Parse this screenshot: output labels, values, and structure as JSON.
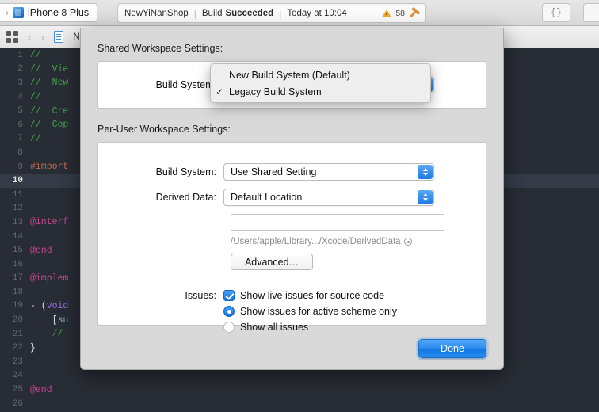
{
  "toolbar": {
    "scheme_separator": "›",
    "device_icon": "device-iphone-icon",
    "scheme_name": "iPhone 8 Plus",
    "project_name": "NewYiNanShop",
    "divider": "|",
    "build_prefix": "Build",
    "build_status": "Succeeded",
    "build_time": "Today at 10:04",
    "warning_icon": "warning-triangle-icon",
    "warning_count": "58",
    "hammer_icon": "hammer-icon",
    "braces_label": "{}"
  },
  "navbar": {
    "grid_icon": "grid-view-icon",
    "back_icon": "‹",
    "forward_icon": "›",
    "file_icon": "document-icon",
    "file_name": "N"
  },
  "editor": {
    "lines": [
      {
        "n": "1",
        "segments": [
          {
            "t": "//",
            "c": "cm"
          }
        ]
      },
      {
        "n": "2",
        "segments": [
          {
            "t": "//  Vie",
            "c": "cm"
          }
        ]
      },
      {
        "n": "3",
        "segments": [
          {
            "t": "//  New",
            "c": "cm"
          }
        ]
      },
      {
        "n": "4",
        "segments": [
          {
            "t": "//",
            "c": "cm"
          }
        ]
      },
      {
        "n": "5",
        "segments": [
          {
            "t": "//  Cre",
            "c": "cm"
          }
        ]
      },
      {
        "n": "6",
        "segments": [
          {
            "t": "//  Cop",
            "c": "cm"
          }
        ]
      },
      {
        "n": "7",
        "segments": [
          {
            "t": "//",
            "c": "cm"
          }
        ]
      },
      {
        "n": "8",
        "segments": []
      },
      {
        "n": "9",
        "segments": [
          {
            "t": "#import",
            "c": "pp"
          }
        ]
      },
      {
        "n": "10",
        "segments": [],
        "highlight": true
      },
      {
        "n": "11",
        "segments": []
      },
      {
        "n": "12",
        "segments": []
      },
      {
        "n": "13",
        "segments": [
          {
            "t": "@interf",
            "c": "kw"
          }
        ]
      },
      {
        "n": "14",
        "segments": []
      },
      {
        "n": "15",
        "segments": [
          {
            "t": "@end",
            "c": "kw"
          }
        ]
      },
      {
        "n": "16",
        "segments": []
      },
      {
        "n": "17",
        "segments": [
          {
            "t": "@implem",
            "c": "kw"
          }
        ]
      },
      {
        "n": "18",
        "segments": []
      },
      {
        "n": "19",
        "segments": [
          {
            "t": "- (",
            "c": "pn"
          },
          {
            "t": "void",
            "c": "ty"
          }
        ]
      },
      {
        "n": "20",
        "segments": [
          {
            "t": "    [",
            "c": "pn"
          },
          {
            "t": "su",
            "c": "id"
          }
        ]
      },
      {
        "n": "21",
        "segments": [
          {
            "t": "    //",
            "c": "cm"
          }
        ]
      },
      {
        "n": "22",
        "segments": [
          {
            "t": "}",
            "c": "pn"
          }
        ]
      },
      {
        "n": "23",
        "segments": []
      },
      {
        "n": "24",
        "segments": []
      },
      {
        "n": "25",
        "segments": [
          {
            "t": "@end",
            "c": "kw"
          }
        ]
      },
      {
        "n": "26",
        "segments": []
      }
    ]
  },
  "sheet": {
    "shared_section_title": "Shared Workspace Settings:",
    "shared_build_system_label": "Build System:",
    "shared_build_system_value": "Legacy Build System",
    "per_user_section_title": "Per-User Workspace Settings:",
    "build_system_label": "Build System:",
    "build_system_value": "Use Shared Setting",
    "derived_data_label": "Derived Data:",
    "derived_data_value": "Default Location",
    "derived_data_path_value": "",
    "derived_data_path_hint": "/Users/apple/Library.../Xcode/DerivedData",
    "reveal_icon": "reveal-in-finder-icon",
    "advanced_label": "Advanced…",
    "issues_label": "Issues:",
    "issue_live": "Show live issues for source code",
    "issue_active_scheme": "Show issues for active scheme only",
    "issue_all": "Show all issues",
    "done_label": "Done"
  },
  "menu": {
    "items": [
      {
        "label": "New Build System (Default)",
        "checked": false
      },
      {
        "label": "Legacy Build System",
        "checked": true
      }
    ],
    "check_glyph": "✓"
  },
  "colors": {
    "accent_blue": "#1274e0",
    "warning_orange": "#f0a82b",
    "editor_bg": "#282c34",
    "sheet_bg": "#d9d9d9"
  }
}
